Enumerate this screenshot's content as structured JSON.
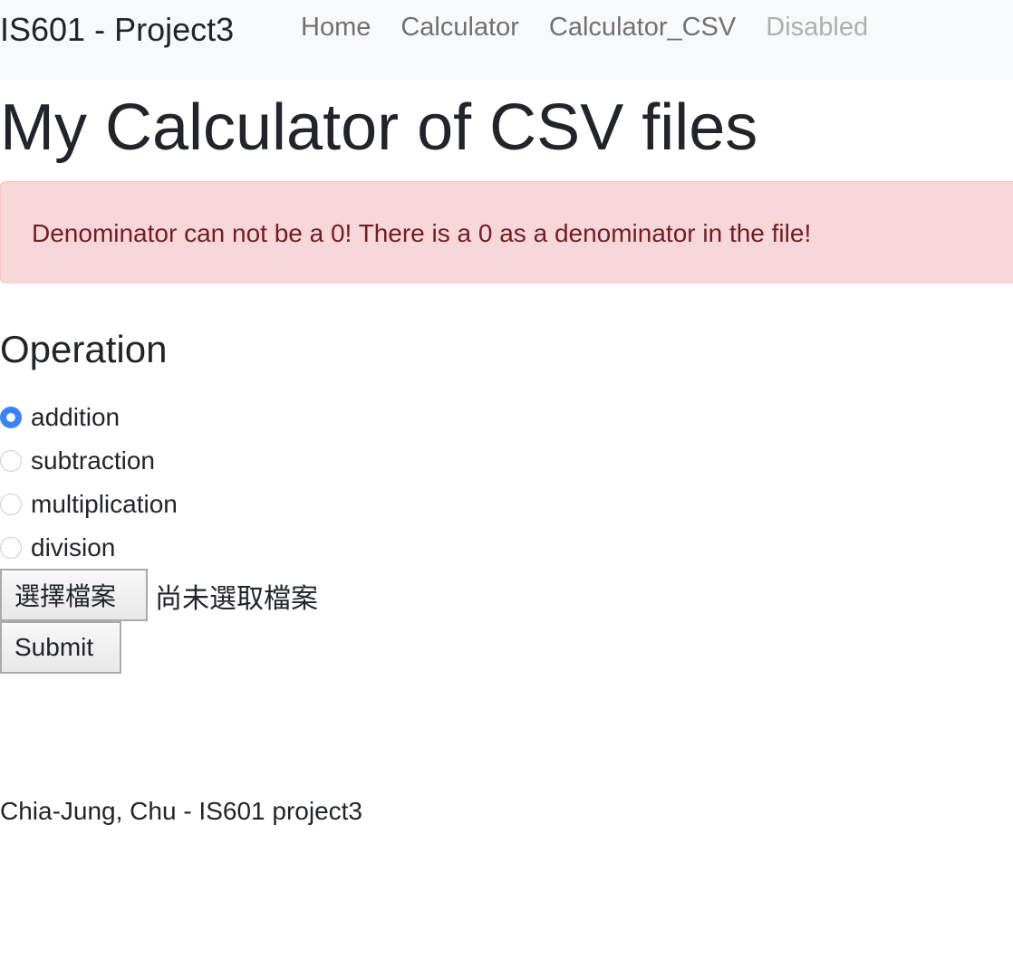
{
  "nav": {
    "brand": "IS601 - Project3",
    "links": [
      "Home",
      "Calculator",
      "Calculator_CSV",
      "Disabled"
    ]
  },
  "title": "My Calculator of CSV files",
  "alert": "Denominator can not be a 0! There is a 0 as a denominator in the file!",
  "form": {
    "heading": "Operation",
    "options": [
      "addition",
      "subtraction",
      "multiplication",
      "division"
    ],
    "selected": "addition",
    "file_button": "選擇檔案",
    "file_status": "尚未選取檔案",
    "submit": "Submit"
  },
  "footer": "Chia-Jung, Chu - IS601 project3"
}
